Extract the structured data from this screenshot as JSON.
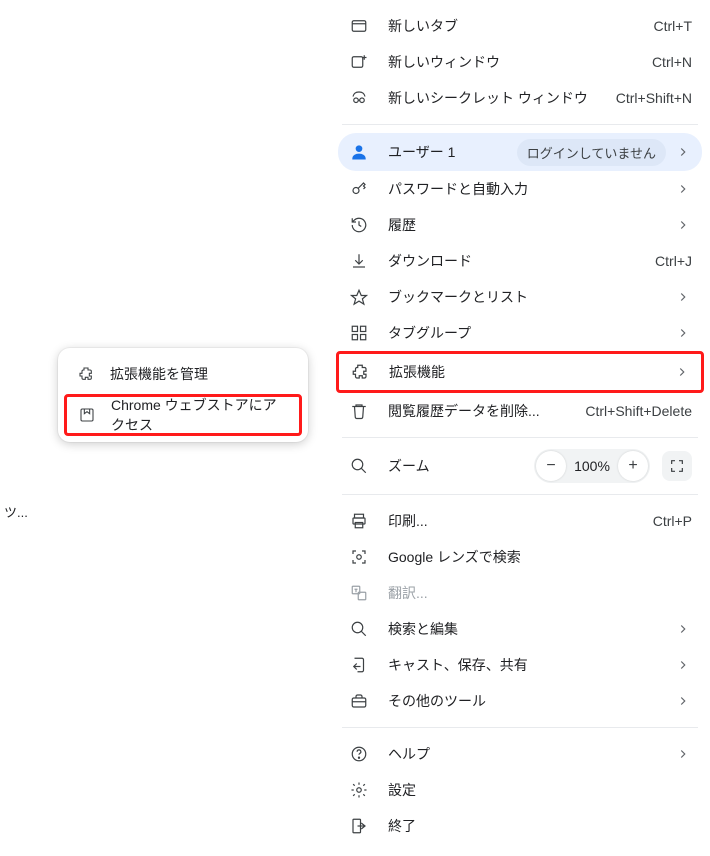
{
  "edge_text": "ツ...",
  "submenu": {
    "manage": "拡張機能を管理",
    "store": "Chrome ウェブストアにアクセス"
  },
  "menu": {
    "new_tab": {
      "label": "新しいタブ",
      "shortcut": "Ctrl+T"
    },
    "new_window": {
      "label": "新しいウィンドウ",
      "shortcut": "Ctrl+N"
    },
    "incognito": {
      "label": "新しいシークレット ウィンドウ",
      "shortcut": "Ctrl+Shift+N"
    },
    "user": {
      "label": "ユーザー 1",
      "status": "ログインしていません"
    },
    "passwords": "パスワードと自動入力",
    "history": "履歴",
    "downloads": {
      "label": "ダウンロード",
      "shortcut": "Ctrl+J"
    },
    "bookmarks": "ブックマークとリスト",
    "tabgroups": "タブグループ",
    "extensions": "拡張機能",
    "clear_data": {
      "label": "閲覧履歴データを削除...",
      "shortcut": "Ctrl+Shift+Delete"
    },
    "zoom": {
      "label": "ズーム",
      "value": "100%"
    },
    "print": {
      "label": "印刷...",
      "shortcut": "Ctrl+P"
    },
    "lens": "Google レンズで検索",
    "translate": "翻訳...",
    "find": "検索と編集",
    "cast": "キャスト、保存、共有",
    "more_tools": "その他のツール",
    "help": "ヘルプ",
    "settings": "設定",
    "exit": "終了"
  }
}
